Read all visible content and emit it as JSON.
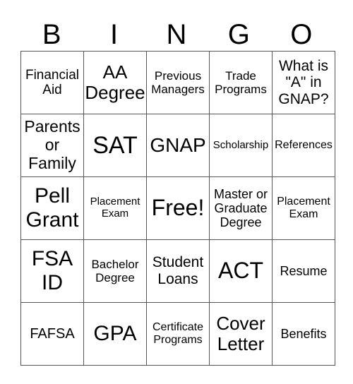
{
  "header": {
    "letters": [
      "B",
      "I",
      "N",
      "G",
      "O"
    ]
  },
  "card": {
    "rows": [
      [
        "Financial\nAid",
        "AA\nDegree",
        "Previous\nManagers",
        "Trade\nPrograms",
        "What is\n\"A\" in\nGNAP?"
      ],
      [
        "Parents\nor\nFamily",
        "SAT",
        "GNAP",
        "Scholarship",
        "References"
      ],
      [
        "Pell\nGrant",
        "Placement\nExam",
        "Free!",
        "Master or\nGraduate\nDegree",
        "Placement\nExam"
      ],
      [
        "FSA\nID",
        "Bachelor\nDegree",
        "Student\nLoans",
        "ACT",
        "Resume"
      ],
      [
        "FAFSA",
        "GPA",
        "Certificate\nPrograms",
        "Cover\nLetter",
        "Benefits"
      ]
    ]
  }
}
